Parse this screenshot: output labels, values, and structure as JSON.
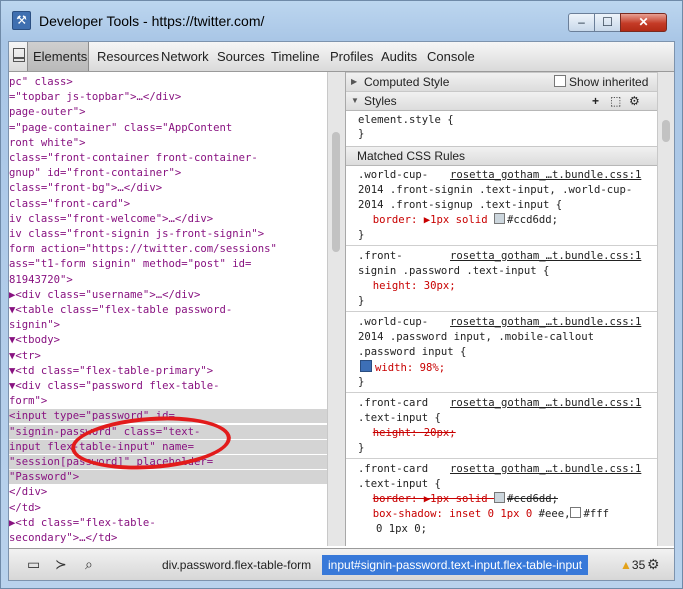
{
  "window": {
    "title": "Developer Tools - https://twitter.com/",
    "buttons": {
      "minimize": "–",
      "maximize": "☐",
      "close": "✕"
    }
  },
  "toolbar": {
    "tabs": [
      "Elements",
      "Resources",
      "Network",
      "Sources",
      "Timeline",
      "Profiles",
      "Audits",
      "Console"
    ],
    "selected": "Elements"
  },
  "elements_tree": {
    "lines": [
      [
        "pc\" class>",
        ""
      ],
      [
        "=\"topbar js-topbar\">…</div>",
        ""
      ],
      [
        "page-outer\">",
        ""
      ],
      [
        "=\"page-container\" class=\"AppContent",
        ""
      ],
      [
        "ront white\">",
        ""
      ],
      [
        "class=\"front-container front-container-",
        ""
      ],
      [
        "gnup\" id=\"front-container\">",
        ""
      ],
      [
        " class=\"front-bg\">…</div>",
        ""
      ],
      [
        "class=\"front-card\">",
        ""
      ],
      [
        "iv class=\"front-welcome\">…</div>",
        ""
      ],
      [
        "iv class=\"front-signin js-front-signin\">",
        ""
      ],
      [
        "form action=\"https://twitter.com/sessions\"",
        ""
      ],
      [
        "ass=\"t1-form signin\" method=\"post\" id=",
        ""
      ],
      [
        "81943720\">",
        ""
      ],
      [
        "▶<div class=\"username\">…</div>",
        ""
      ],
      [
        "▼<table class=\"flex-table password-",
        ""
      ],
      [
        "signin\">",
        ""
      ],
      [
        "  ▼<tbody>",
        ""
      ],
      [
        "    ▼<tr>",
        ""
      ],
      [
        "      ▼<td class=\"flex-table-primary\">",
        ""
      ],
      [
        "        ▼<div class=\"password flex-table-",
        ""
      ],
      [
        "        form\">",
        ""
      ],
      [
        "          <input type=\"password\" id=",
        "sel"
      ],
      [
        "          \"signin-password\" class=\"text-",
        "sel"
      ],
      [
        "          input flex-table-input\" name=",
        "sel"
      ],
      [
        "          \"session[password]\" placeholder=",
        "sel"
      ],
      [
        "          \"Password\">",
        "sel"
      ],
      [
        "          </div>",
        ""
      ],
      [
        "        </td>",
        ""
      ],
      [
        "      ▶<td class=\"flex-table-",
        ""
      ],
      [
        "      secondary\">…</td>",
        ""
      ]
    ]
  },
  "sidebar": {
    "computed_style": "Computed Style",
    "show_inherited": "Show inherited",
    "styles": "Styles",
    "element_style": "element.style {",
    "close_brace": "}",
    "matched_rules": "Matched CSS Rules",
    "rules": [
      {
        "selector_lines": [
          ".world-cup-",
          "2014 .front-signin .text-input, .world-cup-",
          "2014 .front-signup .text-input {"
        ],
        "source": "rosetta_gotham_…t.bundle.css:1",
        "props": [
          {
            "text": "border: ▶1px solid ",
            "value2": "#ccd6dd;",
            "swatch": "#ccd6dd",
            "strike": false,
            "checkbox": false
          }
        ]
      },
      {
        "selector_lines": [
          ".front-",
          "signin .password .text-input {"
        ],
        "source": "rosetta_gotham_…t.bundle.css:1",
        "props": [
          {
            "text": "height: 30px;",
            "strike": false,
            "checkbox": false
          }
        ]
      },
      {
        "selector_lines": [
          ".world-cup-",
          "2014 .password input, .mobile-callout",
          ".password input {"
        ],
        "source": "rosetta_gotham_…t.bundle.css:1",
        "props": [
          {
            "text": "width: 98%;",
            "strike": false,
            "checkbox": true
          }
        ]
      },
      {
        "selector_lines": [
          ".front-card",
          ".text-input {"
        ],
        "source": "rosetta_gotham_…t.bundle.css:1",
        "props": [
          {
            "text": "height: 20px;",
            "strike": true,
            "checkbox": false
          }
        ]
      },
      {
        "selector_lines": [
          ".front-card",
          ".text-input {"
        ],
        "source": "rosetta_gotham_…t.bundle.css:1",
        "props": [
          {
            "text": "border: ▶1px solid ",
            "value2": "#ccd6dd;",
            "swatch": "#ccd6dd",
            "strike": true,
            "checkbox": false
          },
          {
            "text": "box-shadow: inset 0 1px 0 ",
            "value2": "#eee,",
            "value3": "#fff",
            "value4": "0 1px 0;",
            "strike": false,
            "checkbox": false
          }
        ]
      }
    ]
  },
  "statusbar": {
    "crumbs": [
      "div.password.flex-table-form",
      "input#signin-password.text-input.flex-table-input"
    ],
    "warnings": "35"
  },
  "colors": {
    "selection": "#3879d9",
    "annotation_ring": "#e21b1b"
  }
}
